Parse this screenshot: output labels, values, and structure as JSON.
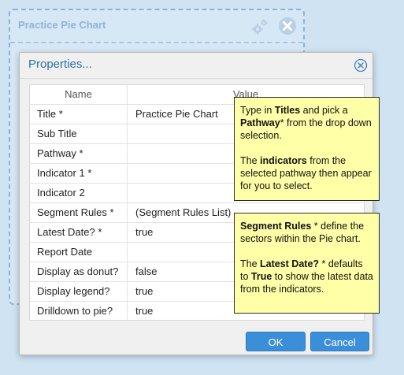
{
  "widget": {
    "title": "Practice Pie Chart"
  },
  "dialog": {
    "title": "Properties...",
    "columns": {
      "name": "Name",
      "value": "Value"
    },
    "rows": [
      {
        "name": "Title *",
        "value": "Practice Pie Chart"
      },
      {
        "name": "Sub Title",
        "value": ""
      },
      {
        "name": "Pathway *",
        "value": ""
      },
      {
        "name": "Indicator 1 *",
        "value": ""
      },
      {
        "name": "Indicator 2",
        "value": ""
      },
      {
        "name": "Segment Rules *",
        "value": "(Segment Rules List)"
      },
      {
        "name": "Latest Date? *",
        "value": "true"
      },
      {
        "name": "Report Date",
        "value": ""
      },
      {
        "name": "Display as donut?",
        "value": "false"
      },
      {
        "name": "Display legend?",
        "value": "true"
      },
      {
        "name": "Drilldown to pie?",
        "value": "true"
      }
    ],
    "ok_label": "OK",
    "cancel_label": "Cancel"
  },
  "tooltip1": {
    "p1": {
      "a": "Type in ",
      "b": "Titles",
      "c": " and pick a ",
      "d": "Pathway",
      "e": "* from the drop down selection."
    },
    "p2": {
      "a": "The ",
      "b": "indicators",
      "c": " from the selected pathway then appear for you to select."
    }
  },
  "tooltip2": {
    "p1": {
      "a": "Segment Rules",
      "b": " * define the sectors within the Pie chart."
    },
    "p2": {
      "a": "The ",
      "b": "Latest Date?",
      "c": " * defaults to ",
      "d": "True",
      "e": " to show the latest data from the indicators."
    }
  },
  "colors": {
    "accent": "#3b8fd9",
    "tooltip_bg": "#ffffa8",
    "title": "#2e6ea6"
  }
}
